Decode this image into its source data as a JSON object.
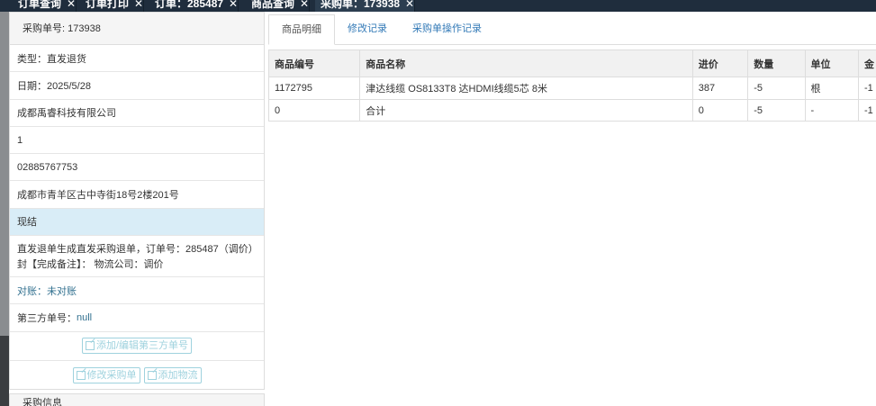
{
  "top_tabs": [
    {
      "label": "订单查询"
    },
    {
      "label": "订单打印"
    },
    {
      "label": "订单：285487"
    },
    {
      "label": "商品查询"
    },
    {
      "label": "采购单：173938"
    }
  ],
  "close_glyph": "✕",
  "left": {
    "header": "采购单号: 173938",
    "type": "类型：直发退货",
    "date": "日期：2025/5/28",
    "company": "成都禹睿科技有限公司",
    "count": "1",
    "phone": "02885767753",
    "address": "成都市青羊区古中寺街18号2楼201号",
    "settle": "现结",
    "note": "直发退单生成直发采购退单，订单号：285487（调价）封【完成备注】： 物流公司：调价",
    "reconcile": "对账：未对账",
    "third_party_label": "第三方单号：",
    "third_party_value": "null",
    "btn_third_party": "添加/编辑第三方单号",
    "btn_edit_order": "修改采购单",
    "btn_add_logistics": "添加物流",
    "next_header": "采购信息"
  },
  "tabs": [
    {
      "label": "商品明细"
    },
    {
      "label": "修改记录"
    },
    {
      "label": "采购单操作记录"
    }
  ],
  "table": {
    "columns": [
      "商品编号",
      "商品名称",
      "进价",
      "数量",
      "单位",
      "金"
    ],
    "rows": [
      [
        "1172795",
        "津达线缆 OS8133T8 达HDMI线缆5芯 8米",
        "387",
        "-5",
        "根",
        "-1"
      ],
      [
        "0",
        "合计",
        "0",
        "-5",
        "-",
        "-1"
      ]
    ]
  }
}
